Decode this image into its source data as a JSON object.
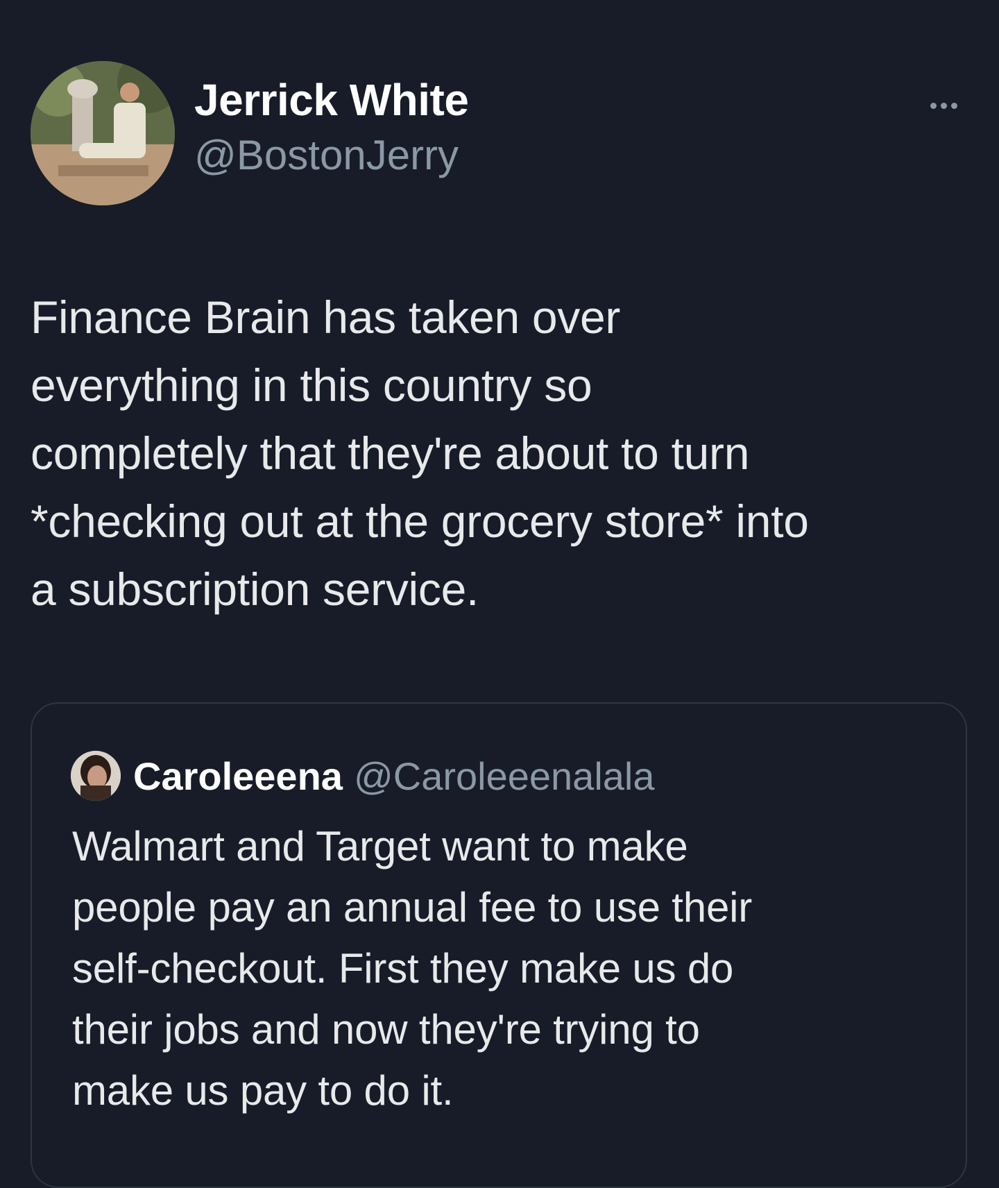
{
  "tweet": {
    "author": {
      "display_name": "Jerrick White",
      "handle": "@BostonJerry",
      "avatar_icon": "profile-photo"
    },
    "more_icon": "more-horizontal-icon",
    "text": "Finance Brain has taken over\neverything in this country so\ncompletely that they're about to turn\n*checking out at the grocery store* into\na subscription service."
  },
  "quoted_tweet": {
    "author": {
      "display_name": "Caroleeena",
      "handle": "@Caroleeenalala",
      "avatar_icon": "profile-photo"
    },
    "text": "Walmart and Target want to make\npeople pay an annual fee to use their\nself-checkout. First they make us do\ntheir jobs and now they're trying to\nmake us pay to do it."
  },
  "colors": {
    "background": "#171c28",
    "primary_text": "#e7e9ea",
    "secondary_text": "#8b98a5",
    "card_border": "#2f3640"
  }
}
